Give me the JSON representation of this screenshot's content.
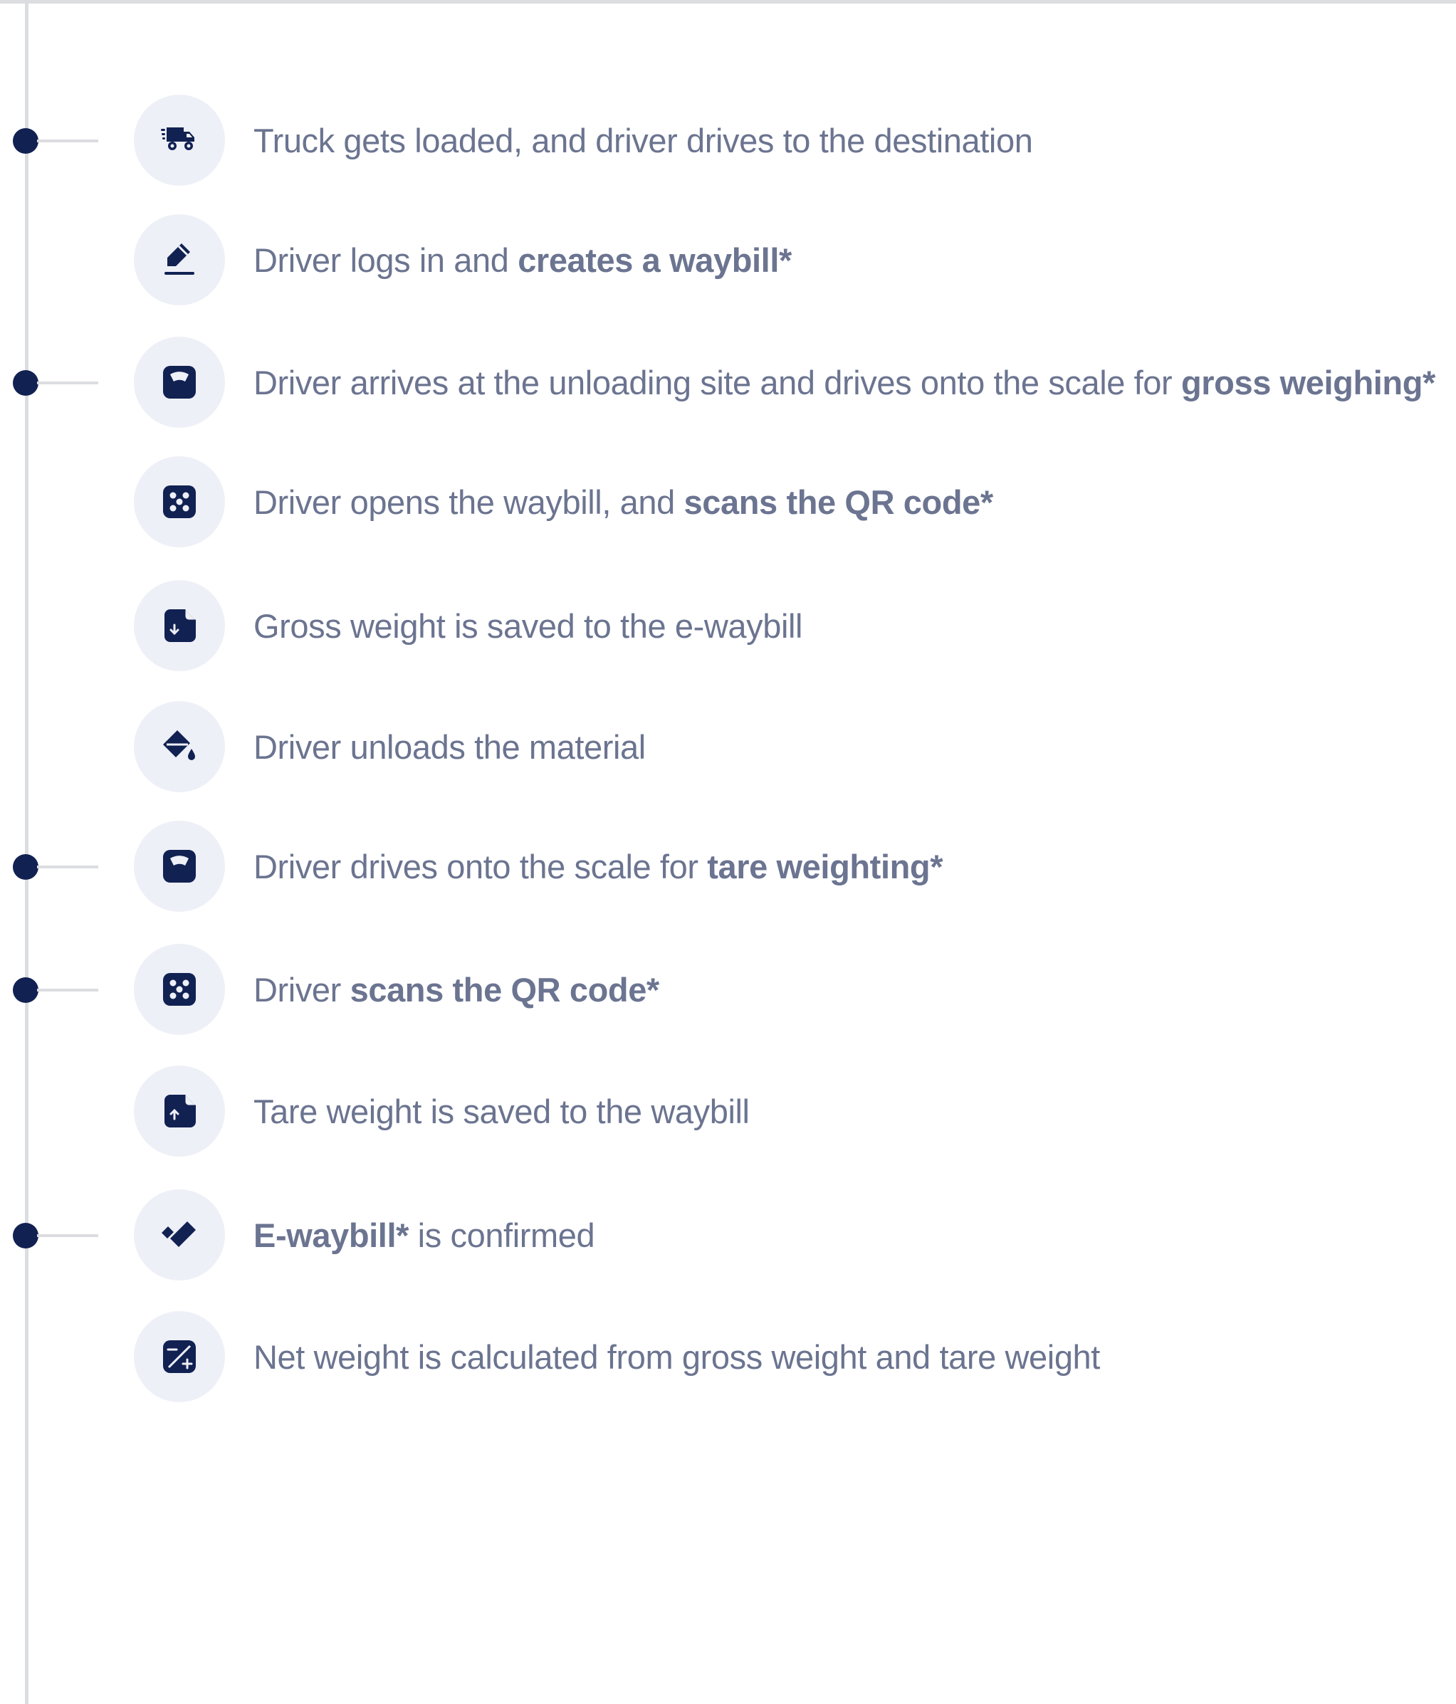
{
  "colors": {
    "marker": "#112152",
    "icon": "#112152",
    "icon_circle": "#eef0f7",
    "rail": "#dcdde1",
    "text": "#6b7490"
  },
  "steps": [
    {
      "icon": "truck-fast-icon",
      "has_marker": true,
      "segments": [
        {
          "text": "Truck gets loaded, and driver drives to the destination",
          "bold": false
        }
      ]
    },
    {
      "icon": "pen-edit-icon",
      "has_marker": false,
      "segments": [
        {
          "text": "Driver logs in and ",
          "bold": false
        },
        {
          "text": "creates a waybill*",
          "bold": true
        }
      ]
    },
    {
      "icon": "weight-scale-icon",
      "has_marker": true,
      "segments": [
        {
          "text": "Driver arrives at the unloading site and drives onto the scale for ",
          "bold": false
        },
        {
          "text": "gross weighing*",
          "bold": true
        }
      ]
    },
    {
      "icon": "qr-scan-icon",
      "has_marker": false,
      "segments": [
        {
          "text": "Driver opens the waybill, and ",
          "bold": false
        },
        {
          "text": "scans the QR code*",
          "bold": true
        }
      ]
    },
    {
      "icon": "file-download-icon",
      "has_marker": false,
      "segments": [
        {
          "text": "Gross weight is saved to the e-waybill",
          "bold": false
        }
      ]
    },
    {
      "icon": "fill-bucket-icon",
      "has_marker": false,
      "segments": [
        {
          "text": "Driver unloads the material",
          "bold": false
        }
      ]
    },
    {
      "icon": "weight-scale-icon",
      "has_marker": true,
      "segments": [
        {
          "text": "Driver drives onto the scale for ",
          "bold": false
        },
        {
          "text": "tare weighting*",
          "bold": true
        }
      ]
    },
    {
      "icon": "qr-scan-icon",
      "has_marker": true,
      "segments": [
        {
          "text": "Driver ",
          "bold": false
        },
        {
          "text": "scans the QR code*",
          "bold": true
        }
      ]
    },
    {
      "icon": "file-upload-icon",
      "has_marker": false,
      "segments": [
        {
          "text": "Tare weight is saved to the waybill",
          "bold": false
        }
      ]
    },
    {
      "icon": "double-check-icon",
      "has_marker": true,
      "segments": [
        {
          "text": "E-waybill*",
          "bold": true
        },
        {
          "text": " is confirmed",
          "bold": false
        }
      ]
    },
    {
      "icon": "calculator-icon",
      "has_marker": false,
      "segments": [
        {
          "text": "Net weight is calculated from gross weight and tare weight",
          "bold": false
        }
      ]
    }
  ]
}
